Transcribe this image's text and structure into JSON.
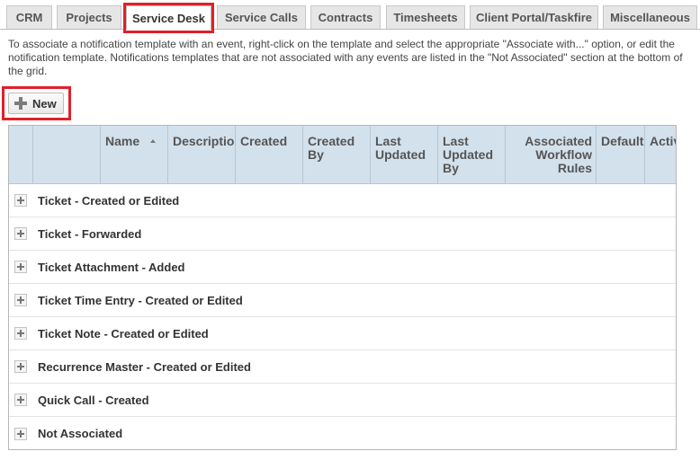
{
  "tabs": [
    {
      "label": "CRM",
      "active": false
    },
    {
      "label": "Projects",
      "active": false
    },
    {
      "label": "Service Desk",
      "active": true
    },
    {
      "label": "Service Calls",
      "active": false
    },
    {
      "label": "Contracts",
      "active": false
    },
    {
      "label": "Timesheets",
      "active": false
    },
    {
      "label": "Client Portal/Taskfire",
      "active": false
    },
    {
      "label": "Miscellaneous",
      "active": false
    }
  ],
  "intro_text": "To associate a notification template with an event, right-click on the template and select the appropriate \"Associate with...\" option, or edit the notification template. Notifications templates that are not associated with any events are listed in the \"Not Associated\" section at the bottom of the grid.",
  "toolbar": {
    "new_label": "New"
  },
  "grid": {
    "columns": [
      {
        "label": "Name",
        "sorted": "ascending"
      },
      {
        "label": "Description"
      },
      {
        "label": "Created"
      },
      {
        "label": "Created By"
      },
      {
        "label": "Last Updated"
      },
      {
        "label": "Last Updated By"
      },
      {
        "label": "Associated Workflow Rules"
      },
      {
        "label": "Default"
      },
      {
        "label": "Active"
      }
    ],
    "groups": [
      {
        "label": "Ticket - Created or Edited"
      },
      {
        "label": "Ticket - Forwarded"
      },
      {
        "label": "Ticket Attachment - Added"
      },
      {
        "label": "Ticket Time Entry - Created or Edited"
      },
      {
        "label": "Ticket Note - Created or Edited"
      },
      {
        "label": "Recurrence Master - Created or Edited"
      },
      {
        "label": "Quick Call - Created"
      },
      {
        "label": "Not Associated"
      }
    ]
  },
  "colors": {
    "highlight": "#e0202a",
    "header_bg": "#d3e1ec",
    "tab_bg": "#e6e6e6"
  }
}
